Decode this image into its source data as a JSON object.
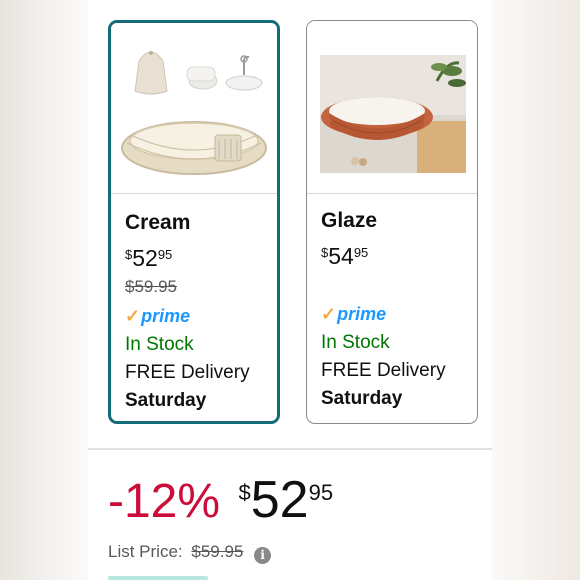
{
  "options": [
    {
      "name": "Cream",
      "price_symbol": "$",
      "price_whole": "52",
      "price_fraction": "95",
      "list_price": "$59.95",
      "prime_label": "prime",
      "stock": "In Stock",
      "delivery": "FREE Delivery",
      "delivery_day": "Saturday",
      "selected": true
    },
    {
      "name": "Glaze",
      "price_symbol": "$",
      "price_whole": "54",
      "price_fraction": "95",
      "prime_label": "prime",
      "stock": "In Stock",
      "delivery": "FREE Delivery",
      "delivery_day": "Saturday",
      "selected": false
    }
  ],
  "summary": {
    "discount": "-12%",
    "price_symbol": "$",
    "price_whole": "52",
    "price_fraction": "95",
    "list_price_label": "List Price:",
    "list_price_value": "$59.95",
    "info_icon": "info-icon"
  },
  "colors": {
    "selected_border": "#146c7a",
    "discount_red": "#cc0c39",
    "in_stock_green": "#007600",
    "prime_blue": "#1a98ff",
    "prime_check": "#f3a847"
  }
}
